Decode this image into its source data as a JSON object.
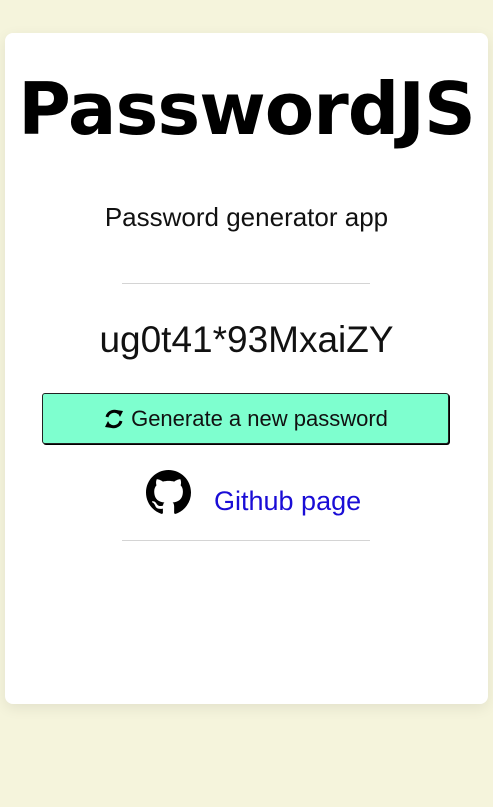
{
  "app": {
    "title": "PasswordJS",
    "subtitle": "Password generator app"
  },
  "password": {
    "value": "ug0t41*93MxaiZY"
  },
  "generate_button": {
    "label": "Generate a new password",
    "icon": "refresh-icon",
    "background_color": "#7effcf"
  },
  "github": {
    "icon": "github-icon",
    "link_label": "Github page",
    "link_color": "#1a0dd6"
  },
  "colors": {
    "page_background": "#f5f4dc",
    "card_background": "#ffffff"
  }
}
